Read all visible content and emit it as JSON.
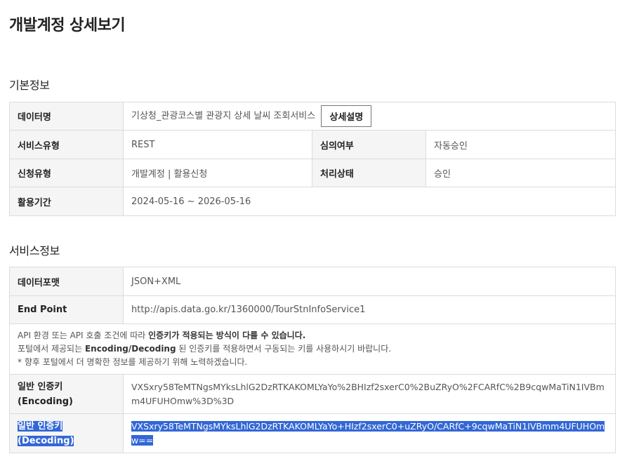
{
  "page_title": "개발계정 상세보기",
  "basic_info": {
    "title": "기본정보",
    "data_name_label": "데이터명",
    "data_name_value": "기상청_관광코스별 관광지 상세 날씨 조회서비스",
    "detail_button": "상세설명",
    "service_type_label": "서비스유형",
    "service_type_value": "REST",
    "review_label": "심의여부",
    "review_value": "자동승인",
    "apply_type_label": "신청유형",
    "apply_type_value": "개발계정 | 활용신청",
    "status_label": "처리상태",
    "status_value": "승인",
    "period_label": "활용기간",
    "period_value": "2024-05-16 ~ 2026-05-16"
  },
  "service_info": {
    "title": "서비스정보",
    "format_label": "데이터포맷",
    "format_value": "JSON+XML",
    "endpoint_label": "End Point",
    "endpoint_value": "http://apis.data.go.kr/1360000/TourStnInfoService1",
    "notice_line1_a": "API 환경 또는 API 호출 조건에 따라 ",
    "notice_line1_b": "인증키가 적용되는 방식이 다를 수 있습니다.",
    "notice_line2_a": "포털에서 제공되는 ",
    "notice_line2_b": "Encoding/Decoding",
    "notice_line2_c": " 된 인증키를 적용하면서 구동되는 키를 사용하시기 바랍니다.",
    "notice_line3": "* 향후 포털에서 더 명확한 정보를 제공하기 위해 노력하겠습니다.",
    "enc_label_1": "일반 인증키",
    "enc_label_2": "(Encoding)",
    "enc_value": "VXSxry58TeMTNgsMYksLhlG2DzRTKAKOMLYaYo%2BHIzf2sxerC0%2BuZRyO%2FCARfC%2B9cqwMaTiN1IVBmm4UFUHOmw%3D%3D",
    "dec_label_1": "일반 인증키",
    "dec_label_2": "(Decoding)",
    "dec_value": "VXSxry58TeMTNgsMYksLhlG2DzRTKAKOMLYaYo+HIzf2sxerC0+uZRyO/CARfC+9cqwMaTiN1IVBmm4UFUHOmw=="
  },
  "colors": {
    "selection": "#3367d6",
    "header_cell": "#f5f5f5",
    "border": "#dcdcdc"
  }
}
